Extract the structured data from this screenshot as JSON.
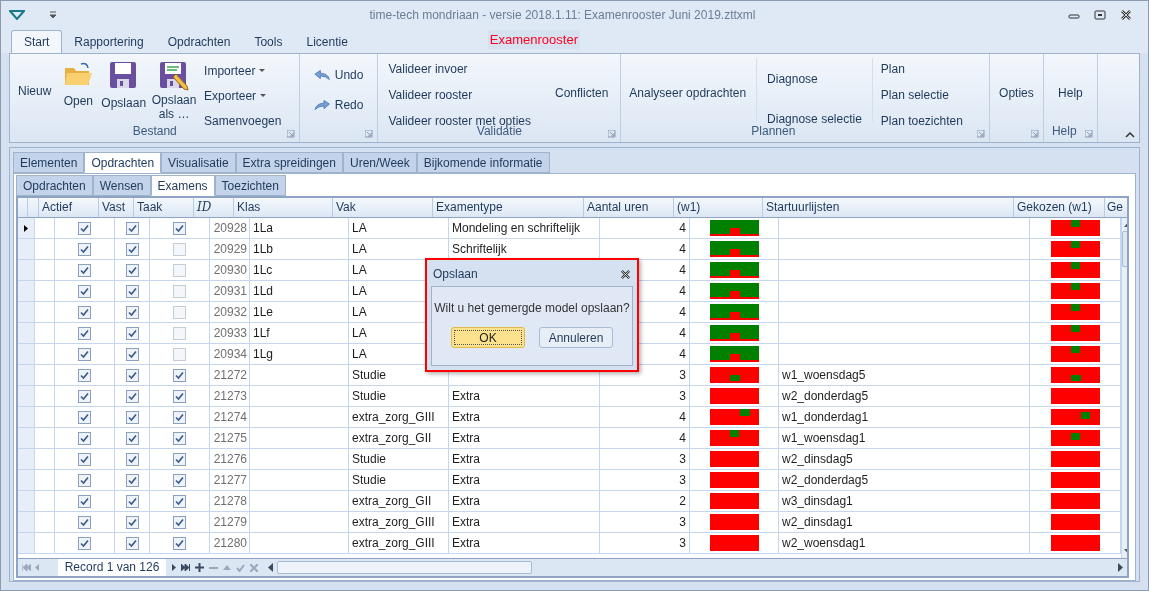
{
  "window": {
    "title": "time-tech mondriaan - versie 2018.1.11: Examenrooster Juni 2019.zttxml"
  },
  "ribbon_tabs": [
    {
      "label": "Start",
      "selected": true
    },
    {
      "label": "Rapportering",
      "selected": false
    },
    {
      "label": "Opdrachten",
      "selected": false
    },
    {
      "label": "Tools",
      "selected": false
    },
    {
      "label": "Licentie",
      "selected": false
    }
  ],
  "context_label": "Examenrooster",
  "ribbon": {
    "bestand": {
      "label": "Bestand",
      "new": "Nieuw",
      "open": "Open",
      "save": "Opslaan",
      "save_as": "Opslaan als …",
      "menus": [
        "Importeer",
        "Exporteer"
      ],
      "merge": "Samenvoegen"
    },
    "history": {
      "undo": "Undo",
      "redo": "Redo"
    },
    "validatie": {
      "label": "Validatie",
      "items": [
        "Valideer invoer",
        "Valideer rooster",
        "Valideer rooster met opties"
      ],
      "conflicts": "Conflicten"
    },
    "plannen": {
      "label": "Plannen",
      "analyse": "Analyseer opdrachten",
      "diagnose": [
        "Diagnose",
        "Diagnose selectie"
      ],
      "plan": [
        "Plan",
        "Plan selectie",
        "Plan toezichten"
      ]
    },
    "opties": {
      "button": "Opties"
    },
    "help": {
      "button": "Help",
      "label": "Help"
    }
  },
  "view_tabs": [
    {
      "label": "Elementen",
      "selected": false
    },
    {
      "label": "Opdrachten",
      "selected": true
    },
    {
      "label": "Visualisatie",
      "selected": false
    },
    {
      "label": "Extra spreidingen",
      "selected": false
    },
    {
      "label": "Uren/Week",
      "selected": false
    },
    {
      "label": "Bijkomende informatie",
      "selected": false
    }
  ],
  "sub_tabs": [
    {
      "label": "Opdrachten",
      "selected": false
    },
    {
      "label": "Wensen",
      "selected": false
    },
    {
      "label": "Examens",
      "selected": true
    },
    {
      "label": "Toezichten",
      "selected": false
    }
  ],
  "table": {
    "columns": [
      "Actief",
      "Vast",
      "Taak",
      "ID",
      "Klas",
      "Vak",
      "Examentype",
      "Aantal uren",
      "(w1)",
      "Startuurlijsten",
      "Gekozen (w1)",
      "Ge"
    ],
    "rows": [
      {
        "selected": true,
        "actief": true,
        "vast": true,
        "taak": true,
        "id": "20928",
        "klas": "1La",
        "vak": "LA",
        "examentype": "Mondeling en schriftelijk",
        "uren": "4",
        "w1": {
          "kind": "green-notch"
        },
        "gekozen": {
          "kind": "dot-top"
        }
      },
      {
        "selected": false,
        "actief": true,
        "vast": true,
        "taak": false,
        "id": "20929",
        "klas": "1Lb",
        "vak": "LA",
        "examentype": "Schriftelijk",
        "uren": "4",
        "w1": {
          "kind": "green-notch"
        },
        "gekozen": {
          "kind": "dot-top"
        }
      },
      {
        "selected": false,
        "actief": true,
        "vast": true,
        "taak": false,
        "id": "20930",
        "klas": "1Lc",
        "vak": "LA",
        "uren": "4",
        "w1": {
          "kind": "green-notch"
        },
        "gekozen": {
          "kind": "dot-top"
        }
      },
      {
        "selected": false,
        "actief": true,
        "vast": true,
        "taak": false,
        "id": "20931",
        "klas": "1Ld",
        "vak": "LA",
        "uren": "4",
        "w1": {
          "kind": "green-notch"
        },
        "gekozen": {
          "kind": "dot-top"
        }
      },
      {
        "selected": false,
        "actief": true,
        "vast": true,
        "taak": false,
        "id": "20932",
        "klas": "1Le",
        "vak": "LA",
        "uren": "4",
        "w1": {
          "kind": "green-notch"
        },
        "gekozen": {
          "kind": "dot-top"
        }
      },
      {
        "selected": false,
        "actief": true,
        "vast": true,
        "taak": false,
        "id": "20933",
        "klas": "1Lf",
        "vak": "LA",
        "uren": "4",
        "w1": {
          "kind": "green-notch"
        },
        "gekozen": {
          "kind": "dot-top"
        }
      },
      {
        "selected": false,
        "actief": true,
        "vast": true,
        "taak": false,
        "id": "20934",
        "klas": "1Lg",
        "vak": "LA",
        "uren": "4",
        "w1": {
          "kind": "green-notch"
        },
        "gekozen": {
          "kind": "dot-top"
        }
      },
      {
        "selected": false,
        "actief": true,
        "vast": true,
        "taak": true,
        "id": "21272",
        "vak": "Studie",
        "uren": "3",
        "startuurlijst": "w1_woensdag5",
        "w1": {
          "kind": "dot-low"
        },
        "gekozen": {
          "kind": "dot-low"
        }
      },
      {
        "selected": false,
        "actief": true,
        "vast": true,
        "taak": true,
        "id": "21273",
        "vak": "Studie",
        "examentype": "Extra",
        "uren": "3",
        "startuurlijst": "w2_donderdag5",
        "w1": {
          "kind": "plain"
        },
        "gekozen": {
          "kind": "plain"
        }
      },
      {
        "selected": false,
        "actief": true,
        "vast": true,
        "taak": true,
        "id": "21274",
        "vak": "extra_zorg_GIII",
        "examentype": "Extra",
        "uren": "4",
        "startuurlijst": "w1_donderdag1",
        "w1": {
          "kind": "dot-top-right"
        },
        "gekozen": {
          "kind": "dot-mid-right"
        }
      },
      {
        "selected": false,
        "actief": true,
        "vast": true,
        "taak": true,
        "id": "21275",
        "vak": "extra_zorg_GII",
        "examentype": "Extra",
        "uren": "4",
        "startuurlijst": "w1_woensdag1",
        "w1": {
          "kind": "dot-top"
        },
        "gekozen": {
          "kind": "dot-mid"
        }
      },
      {
        "selected": false,
        "actief": true,
        "vast": true,
        "taak": true,
        "id": "21276",
        "vak": "Studie",
        "examentype": "Extra",
        "uren": "3",
        "startuurlijst": "w2_dinsdag5",
        "w1": {
          "kind": "plain"
        },
        "gekozen": {
          "kind": "plain"
        }
      },
      {
        "selected": false,
        "actief": true,
        "vast": true,
        "taak": true,
        "id": "21277",
        "vak": "Studie",
        "examentype": "Extra",
        "uren": "3",
        "startuurlijst": "w2_donderdag5",
        "w1": {
          "kind": "plain"
        },
        "gekozen": {
          "kind": "plain"
        }
      },
      {
        "selected": false,
        "actief": true,
        "vast": true,
        "taak": true,
        "id": "21278",
        "vak": "extra_zorg_GII",
        "examentype": "Extra",
        "uren": "2",
        "startuurlijst": "w3_dinsdag1",
        "w1": {
          "kind": "plain"
        },
        "gekozen": {
          "kind": "plain"
        }
      },
      {
        "selected": false,
        "actief": true,
        "vast": true,
        "taak": true,
        "id": "21279",
        "vak": "extra_zorg_GIII",
        "examentype": "Extra",
        "uren": "3",
        "startuurlijst": "w2_dinsdag1",
        "w1": {
          "kind": "plain"
        },
        "gekozen": {
          "kind": "plain"
        }
      },
      {
        "selected": false,
        "actief": true,
        "vast": true,
        "taak": true,
        "id": "21280",
        "vak": "extra_zorg_GIII",
        "examentype": "Extra",
        "uren": "3",
        "startuurlijst": "w2_woensdag1",
        "w1": {
          "kind": "plain"
        },
        "gekozen": {
          "kind": "plain"
        }
      }
    ]
  },
  "navigator": {
    "record": "Record 1 van 126"
  },
  "dialog": {
    "title": "Opslaan",
    "message": "Wilt u het gemergde model opslaan?",
    "buttons": [
      {
        "label": "OK",
        "default": true
      },
      {
        "label": "Annuleren",
        "default": false
      }
    ]
  }
}
